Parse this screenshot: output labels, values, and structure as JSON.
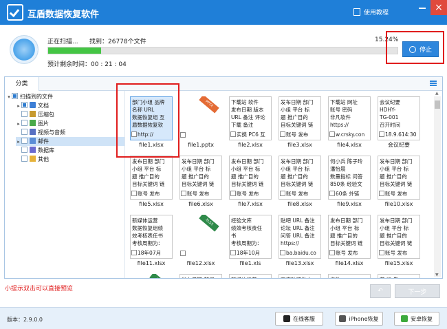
{
  "app": {
    "title": "互盾数据恢复软件",
    "help_label": "使用教程",
    "close_glyph": "×"
  },
  "scan": {
    "status": "正在扫描...",
    "found_label": "找到：26778个文件",
    "percent_text": "15.24%",
    "progress": 0.1524,
    "remaining": "预计剩余时间：00 : 21 : 04",
    "stop_label": "停止"
  },
  "tabs": [
    {
      "label": "分类"
    }
  ],
  "tree": [
    {
      "label": "扫描到的文件",
      "icon": "folder-icon"
    },
    {
      "label": "文档",
      "icon": "document-icon"
    },
    {
      "label": "压缩包",
      "icon": "archive-icon"
    },
    {
      "label": "图片",
      "icon": "image-icon"
    },
    {
      "label": "视频与音频",
      "icon": "video-icon"
    },
    {
      "label": "邮件",
      "icon": "mail-icon"
    },
    {
      "label": "数据库",
      "icon": "database-icon"
    },
    {
      "label": "其他",
      "icon": "other-icon"
    }
  ],
  "files": [
    {
      "name": "file1.xlsx",
      "lines": [
        "部门小组 品牌",
        "名称 URL",
        "数据恢复组 互",
        "盾数据恢复软"
      ],
      "check_text": "http://"
    },
    {
      "name": "file1.pptx",
      "icon": "pptx",
      "ribbon": "PPTX"
    },
    {
      "name": "file2.xlsx",
      "lines": [
        "下载站 软件",
        "发布日期 版本",
        "URL 备注 评论",
        "下载 备注"
      ],
      "check_text": "实携 PC6 互"
    },
    {
      "name": "file3.xlsx",
      "lines": [
        "发布日期 部门",
        "小组 平台 标",
        "题 推广目的",
        "目标关键词 链"
      ],
      "check_text": "账号 发布"
    },
    {
      "name": "file4.xlsx",
      "lines": [
        "下载站 网址",
        "账号 密码",
        "非凡软件",
        "https://"
      ],
      "check_text": "w.crsky.con"
    },
    {
      "name": "会议纪要",
      "lines": [
        "会议纪要",
        "HDHY-",
        "TG-001",
        "召开时间"
      ],
      "check_text": "18.9.614:30"
    },
    {
      "name": "file5.xlsx",
      "lines": [
        "发布日期 部门",
        "小组 平台 标",
        "题 推广目的",
        "目标关键词 链"
      ],
      "check_text": "账号 发布"
    },
    {
      "name": "file6.xlsx",
      "lines": [
        "发布日期 部门",
        "小组 平台 标",
        "题 推广目的",
        "目标关键词 链"
      ],
      "check_text": "账号 发布"
    },
    {
      "name": "file7.xlsx",
      "lines": [
        "发布日期 部门",
        "小组 平台 标",
        "题 推广目的",
        "目标关键词 链"
      ],
      "check_text": "账号 发布"
    },
    {
      "name": "file8.xlsx",
      "lines": [
        "发布日期 部门",
        "小组 平台 标",
        "题 推广目的",
        "目标关键词 链"
      ],
      "check_text": "账号 发布"
    },
    {
      "name": "file9.xlsx",
      "lines": [
        "何小兵 陈子玲",
        "潘怡晨",
        "数量指标 问答",
        "850条 经验文"
      ],
      "check_text": "60条 外链"
    },
    {
      "name": "file10.xlsx",
      "lines": [
        "发布日期 部门",
        "小组 平台 标",
        "题 推广目的",
        "目标关键词 链"
      ],
      "check_text": "账号 发布"
    },
    {
      "name": "file11.xlsx",
      "lines": [
        "新媒体运营",
        "数据恢复组绩",
        "效考核表任书",
        "考核周期为："
      ],
      "check_text": "18年07月"
    },
    {
      "name": "file12.xlsx",
      "icon": "xlsx",
      "ribbon": "XLSX"
    },
    {
      "name": "file1.xls",
      "lines": [
        "经验文库",
        "绩效考核责任",
        "书",
        "考核周期为："
      ],
      "check_text": "18年10月"
    },
    {
      "name": "file13.xlsx",
      "lines": [
        "贴吧 URL 备注",
        "论坛 URL 备注",
        "问答 URL 备注",
        "https://"
      ],
      "check_text": "ba.baidu.co"
    },
    {
      "name": "file14.xlsx",
      "lines": [
        "发布日期 部门",
        "小组 平台 标",
        "题 推广目的",
        "目标关键词 链"
      ],
      "check_text": "账号 发布"
    },
    {
      "name": "file15.xlsx",
      "lines": [
        "发布日期 部门",
        "小组 平台 标",
        "题 推广目的",
        "目标关键词 链"
      ],
      "check_text": "账号 发布"
    },
    {
      "name": "",
      "icon": "xlsx",
      "ribbon": "XLSX"
    },
    {
      "name": "",
      "lines": [
        "发布日期 部门"
      ],
      "check_text": ""
    },
    {
      "name": "",
      "lines": [
        "新媒体运营"
      ],
      "check_text": ""
    },
    {
      "name": "",
      "lines": [
        "百度贴吧推广"
      ],
      "check_text": ""
    },
    {
      "name": "",
      "lines": [
        "指数"
      ],
      "check_text": ""
    },
    {
      "name": "",
      "lines": [
        "营 运 告"
      ],
      "check_text": ""
    }
  ],
  "tip": "小提示双击可以直接预览",
  "nav": {
    "back_glyph": "↶",
    "next_label": "下一步"
  },
  "footer": {
    "version": "版本：2.9.0.0",
    "buttons": [
      {
        "label": "在线客服",
        "icon": "customer-service-icon",
        "color": "#222222"
      },
      {
        "label": "iPhone恢复",
        "icon": "phone-icon",
        "color": "#555555"
      },
      {
        "label": "安卓恢复",
        "icon": "android-icon",
        "color": "#3daa3d"
      }
    ]
  }
}
